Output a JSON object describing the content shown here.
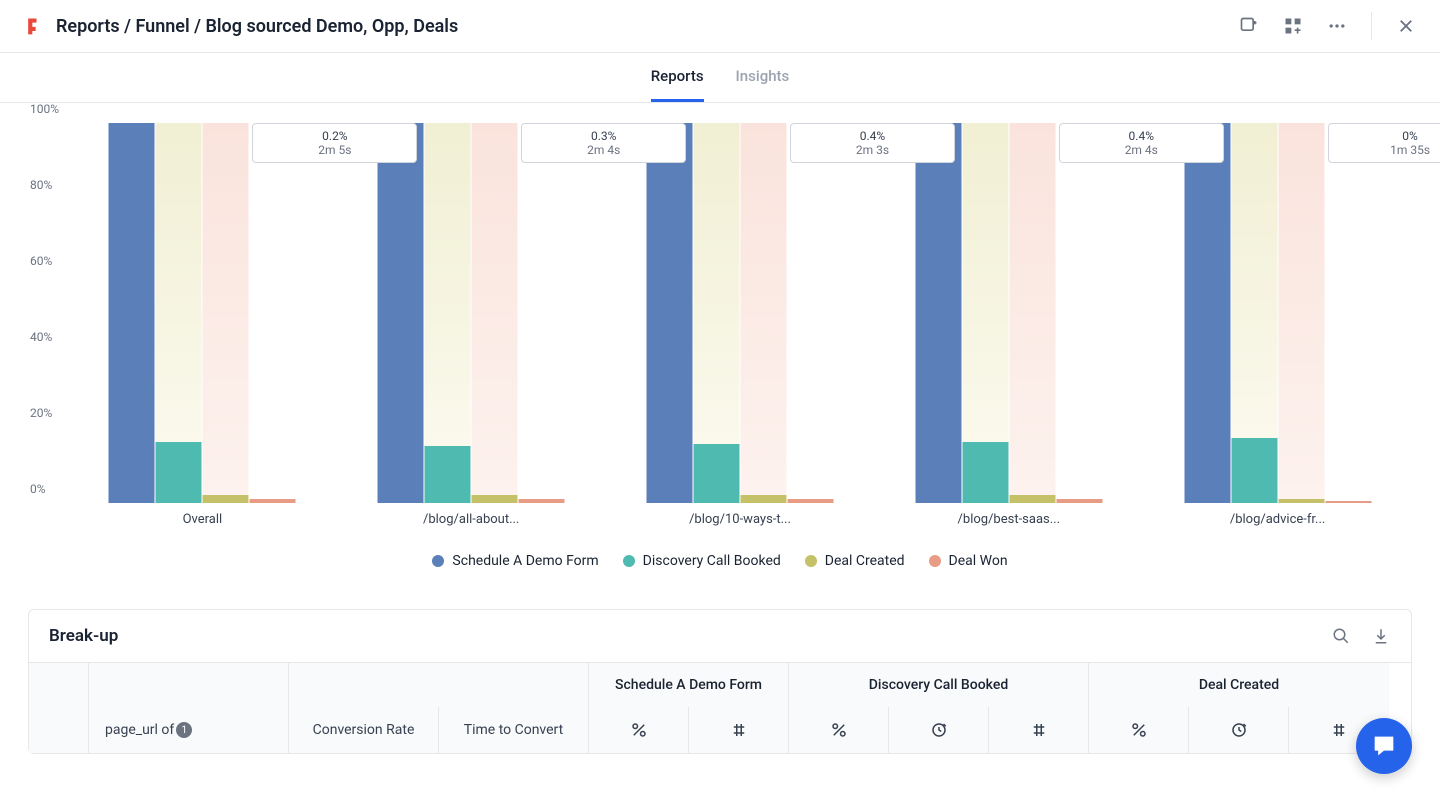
{
  "header": {
    "breadcrumb": "Reports / Funnel / Blog sourced Demo, Opp, Deals"
  },
  "tabs": [
    {
      "label": "Reports",
      "active": true
    },
    {
      "label": "Insights",
      "active": false
    }
  ],
  "chart_data": {
    "type": "bar",
    "ylabel": "",
    "ylim": [
      0,
      100
    ],
    "yticks": [
      "0%",
      "20%",
      "40%",
      "60%",
      "80%",
      "100%"
    ],
    "categories": [
      "Overall",
      "/blog/all-about...",
      "/blog/10-ways-t...",
      "/blog/best-saas...",
      "/blog/advice-fr..."
    ],
    "series": [
      {
        "name": "Schedule A Demo Form",
        "color": "#5b7fb8",
        "values": [
          100,
          100,
          100,
          100,
          100
        ]
      },
      {
        "name": "Discovery Call Booked",
        "color": "#4fbab0",
        "values": [
          16,
          15,
          15.5,
          16,
          17
        ]
      },
      {
        "name": "Deal Created",
        "color": "#c4c168",
        "values": [
          2,
          2,
          2,
          2,
          1
        ]
      },
      {
        "name": "Deal Won",
        "color": "#e89b85",
        "values": [
          1,
          1,
          1,
          1,
          0.5
        ]
      }
    ],
    "spacers": [
      [
        16,
        2,
        1,
        0
      ],
      [
        15,
        2,
        1,
        0
      ],
      [
        15.5,
        2,
        1,
        0
      ],
      [
        16,
        2,
        1,
        0
      ],
      [
        17,
        1,
        0.5,
        0
      ]
    ],
    "annotations": [
      {
        "pct": "0.2%",
        "time": "2m 5s"
      },
      {
        "pct": "0.3%",
        "time": "2m 4s"
      },
      {
        "pct": "0.4%",
        "time": "2m 3s"
      },
      {
        "pct": "0.4%",
        "time": "2m 4s"
      },
      {
        "pct": "0%",
        "time": "1m 35s"
      }
    ]
  },
  "legend": [
    {
      "label": "Schedule A Demo Form",
      "color": "#5b7fb8"
    },
    {
      "label": "Discovery Call Booked",
      "color": "#4fbab0"
    },
    {
      "label": "Deal Created",
      "color": "#c4c168"
    },
    {
      "label": "Deal Won",
      "color": "#e89b85"
    }
  ],
  "breakup": {
    "title": "Break-up",
    "row_label": "page_url of",
    "row_badge": "1",
    "conv_rate": "Conversion Rate",
    "time_conv": "Time to Convert",
    "cols": [
      "Schedule A Demo Form",
      "Discovery Call Booked",
      "Deal Created"
    ]
  }
}
